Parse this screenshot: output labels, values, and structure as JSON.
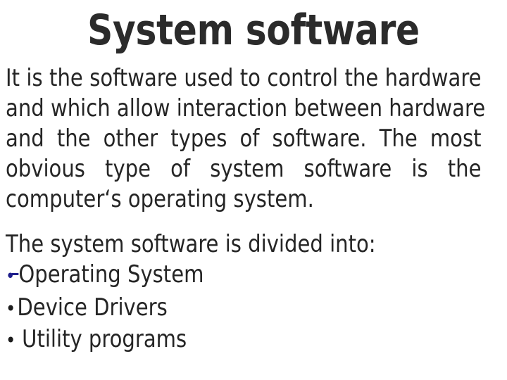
{
  "slide": {
    "background_color": "#ffffff",
    "text_color": "#252525",
    "title_color": "#2b2b2b",
    "title": "System software"
  },
  "body": {
    "lines": [
      "It is the software used to control the hardware",
      "and which allow interaction between hardware",
      "and the other types of software. The most",
      "obvious type of system software is the",
      "computer‘s operating system."
    ],
    "full_text": "It is the software used to control the hardware and which allow interaction between hardware and the other types of software. The most obvious type of system software is the computer‘s operating system."
  },
  "list_section": {
    "intro": "The system software is divided into:",
    "items": [
      {
        "bullet": "•",
        "bullet_color": "#1f1f8c",
        "spaced": false,
        "label": "Operating System"
      },
      {
        "bullet": "•",
        "bullet_color": "#1c1c1c",
        "spaced": false,
        "label": "Device Drivers"
      },
      {
        "bullet": "•",
        "bullet_color": "#1c1c1c",
        "spaced": true,
        "label": "Utility programs"
      }
    ]
  }
}
